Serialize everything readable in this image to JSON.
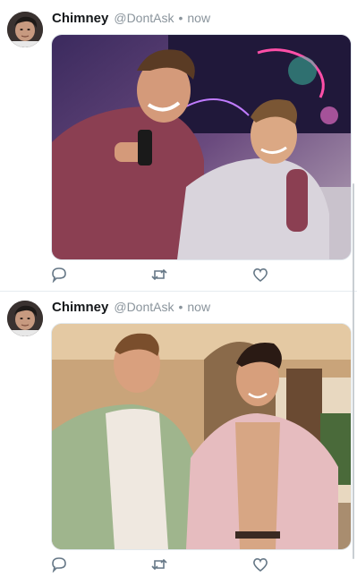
{
  "tweets": [
    {
      "author_name": "Chimney",
      "handle": "@DontAsk",
      "separator": "•",
      "time": "now",
      "icons": {
        "reply": "reply-icon",
        "retweet": "retweet-icon",
        "like": "heart-icon"
      }
    },
    {
      "author_name": "Chimney",
      "handle": "@DontAsk",
      "separator": "•",
      "time": "now",
      "icons": {
        "reply": "reply-icon",
        "retweet": "retweet-icon",
        "like": "heart-icon"
      }
    }
  ],
  "colors": {
    "text_primary": "#14171a",
    "text_secondary": "#8a949c",
    "icon": "#657786",
    "divider": "#e6ecf0"
  }
}
